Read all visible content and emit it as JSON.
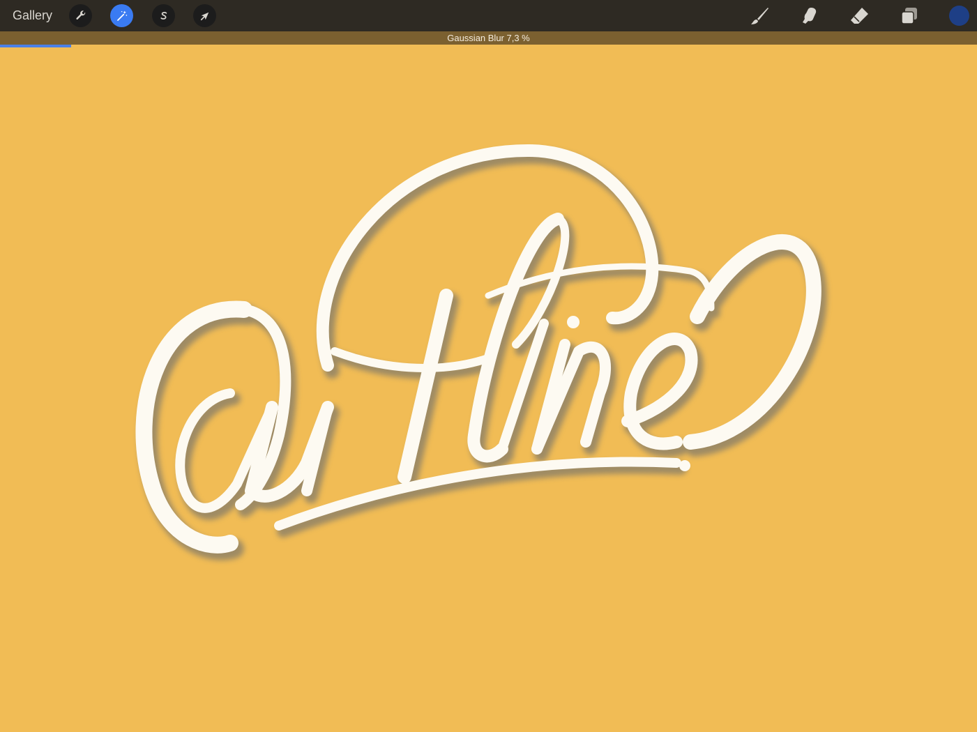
{
  "toolbar": {
    "gallery_label": "Gallery",
    "left_tools": [
      {
        "name": "actions",
        "icon": "wrench-icon"
      },
      {
        "name": "adjustments",
        "icon": "magic-wand-icon",
        "active": true
      },
      {
        "name": "selection",
        "icon": "selection-s-icon"
      },
      {
        "name": "transform",
        "icon": "arrow-cursor-icon"
      }
    ],
    "right_tools": [
      {
        "name": "brush",
        "icon": "brush-icon"
      },
      {
        "name": "smudge",
        "icon": "smudge-finger-icon"
      },
      {
        "name": "eraser",
        "icon": "eraser-icon"
      },
      {
        "name": "layers",
        "icon": "layers-icon"
      }
    ],
    "current_color": "#1E3F86"
  },
  "adjustment": {
    "label": "Gaussian Blur 7,3 %",
    "progress_fraction": 0.073,
    "progress_color": "#4A80E8"
  },
  "canvas": {
    "background_color": "#F1BC55",
    "artwork_text": "Outline",
    "artwork_color": "#FDFAF2",
    "shadow_color": "#5C6470"
  }
}
